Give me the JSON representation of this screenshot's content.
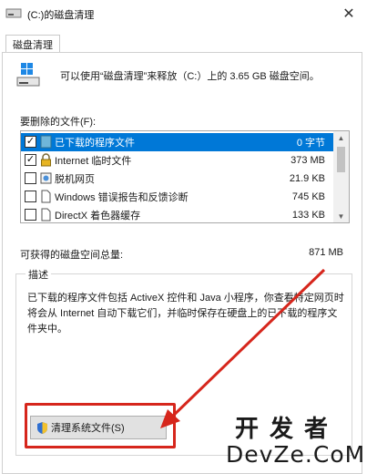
{
  "window": {
    "title": "(C:)的磁盘清理"
  },
  "tabs": [
    {
      "label": "磁盘清理"
    }
  ],
  "intro": {
    "text": "可以使用“磁盘清理”来释放（C:）上的 3.65 GB 磁盘空间。"
  },
  "files": {
    "label": "要删除的文件(F):",
    "items": [
      {
        "name": "已下载的程序文件",
        "size": "0 字节",
        "checked": true,
        "selected": true,
        "icon": "folder-icon"
      },
      {
        "name": "Internet 临时文件",
        "size": "373 MB",
        "checked": true,
        "selected": false,
        "icon": "lock-icon"
      },
      {
        "name": "脱机网页",
        "size": "21.9 KB",
        "checked": false,
        "selected": false,
        "icon": "offline-page-icon"
      },
      {
        "name": "Windows 错误报告和反馈诊断",
        "size": "745 KB",
        "checked": false,
        "selected": false,
        "icon": "file-icon"
      },
      {
        "name": "DirectX 着色器缓存",
        "size": "133 KB",
        "checked": false,
        "selected": false,
        "icon": "file-icon"
      }
    ]
  },
  "total": {
    "label": "可获得的磁盘空间总量:",
    "value": "871 MB"
  },
  "description": {
    "title": "描述",
    "text": "已下载的程序文件包括 ActiveX 控件和 Java 小程序，你查看特定网页时将会从 Internet 自动下载它们，并临时保存在硬盘上的已下载的程序文件夹中。"
  },
  "buttons": {
    "clean_system": "清理系统文件(S)"
  },
  "watermark": {
    "line1": "开发者",
    "line2": "DevZe.CoM"
  },
  "colors": {
    "selection": "#0078d7",
    "highlight": "#d6261c"
  }
}
